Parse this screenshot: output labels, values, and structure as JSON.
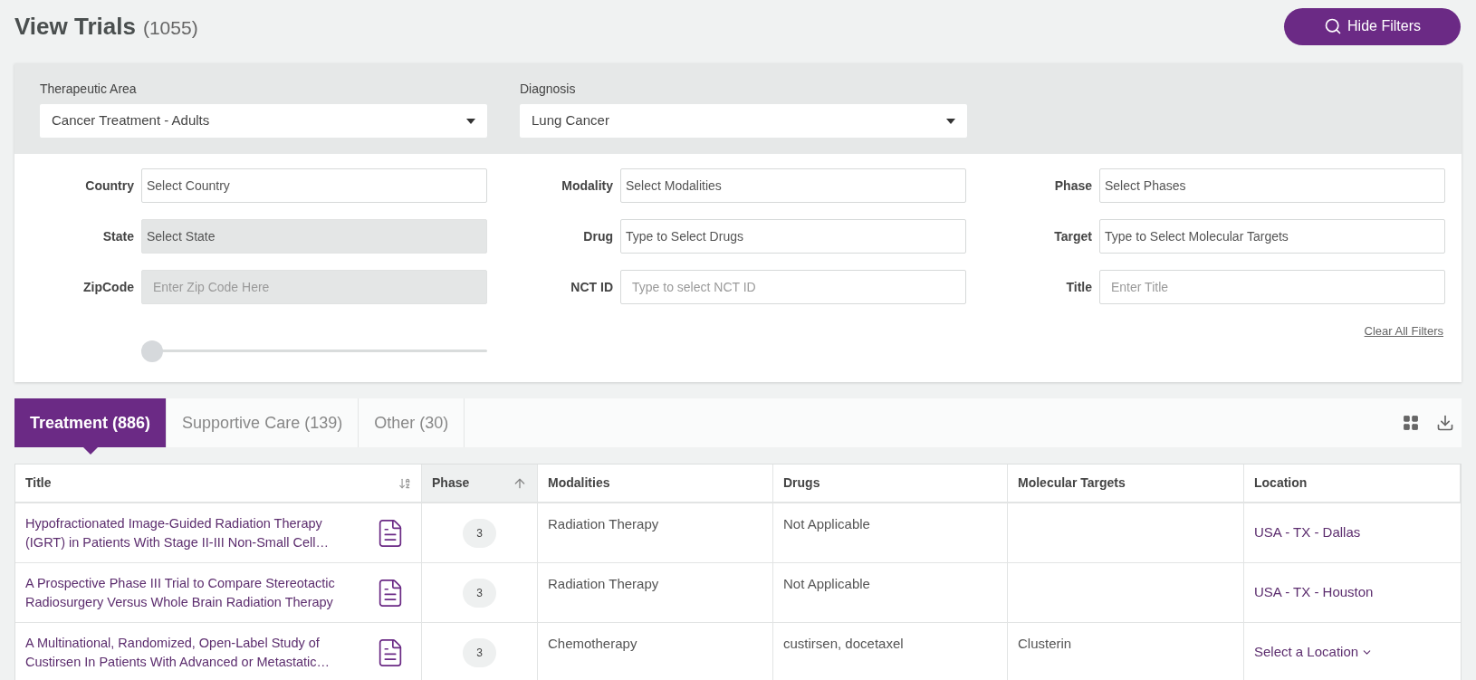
{
  "header": {
    "title": "View Trials",
    "count": "(1055)",
    "button": "Hide Filters"
  },
  "top_filters": [
    {
      "label": "Therapeutic Area",
      "value": "Cancer Treatment - Adults"
    },
    {
      "label": "Diagnosis",
      "value": "Lung Cancer"
    }
  ],
  "filter_columns": [
    [
      {
        "label": "Country",
        "placeholder": "Select Country",
        "kind": "select",
        "disabled": false
      },
      {
        "label": "State",
        "placeholder": "Select State",
        "kind": "select",
        "disabled": true
      },
      {
        "label": "ZipCode",
        "placeholder": "Enter Zip Code Here",
        "kind": "input",
        "disabled": true
      }
    ],
    [
      {
        "label": "Modality",
        "placeholder": "Select Modalities",
        "kind": "select",
        "disabled": false
      },
      {
        "label": "Drug",
        "placeholder": "Type to Select Drugs",
        "kind": "select",
        "disabled": false
      },
      {
        "label": "NCT ID",
        "placeholder": "Type to select NCT ID",
        "kind": "input",
        "disabled": false
      }
    ],
    [
      {
        "label": "Phase",
        "placeholder": "Select Phases",
        "kind": "select",
        "disabled": false
      },
      {
        "label": "Target",
        "placeholder": "Type to Select Molecular Targets",
        "kind": "select",
        "disabled": false
      },
      {
        "label": "Title",
        "placeholder": "Enter Title",
        "kind": "input",
        "disabled": false
      }
    ]
  ],
  "distance_slider": {
    "level": 0
  },
  "clear_link": "Clear All Filters",
  "tabs": [
    {
      "label": "Treatment",
      "count": "(886)",
      "selected": true
    },
    {
      "label": "Supportive Care",
      "count": "(139)",
      "selected": false
    },
    {
      "label": "Other",
      "count": "(30)",
      "selected": false
    }
  ],
  "table": {
    "columns": [
      {
        "label": "Title",
        "sorted": false,
        "alpha_sortable": true
      },
      {
        "label": "Phase",
        "sorted": true,
        "alpha_sortable": false
      },
      {
        "label": "Modalities",
        "sorted": false,
        "alpha_sortable": false
      },
      {
        "label": "Drugs",
        "sorted": false,
        "alpha_sortable": false
      },
      {
        "label": "Molecular Targets",
        "sorted": false,
        "alpha_sortable": false
      },
      {
        "label": "Location",
        "sorted": false,
        "alpha_sortable": false
      }
    ],
    "rows": [
      {
        "title": "Hypofractionated Image-Guided Radiation Therapy (IGRT) in Patients With Stage II-III Non-Small Cell…",
        "phase": "3",
        "modalities": "Radiation Therapy",
        "drugs": "Not Applicable",
        "location": {
          "text": "USA - TX - Dallas",
          "kind": "link"
        }
      },
      {
        "title": "A Prospective Phase III Trial to Compare Stereotactic Radiosurgery Versus Whole Brain Radiation Therapy",
        "phase": "3",
        "modalities": "Radiation Therapy",
        "drugs": "Not Applicable",
        "location": {
          "text": "USA - TX - Houston",
          "kind": "link"
        }
      },
      {
        "title": "A Multinational, Randomized, Open-Label Study of Custirsen In Patients With Advanced or Metastatic…",
        "phase": "3",
        "modalities": "Chemotherapy",
        "drugs": "custirsen, docetaxel",
        "targets": "Clusterin",
        "location": {
          "text": "Select a Location",
          "kind": "select"
        }
      }
    ]
  }
}
